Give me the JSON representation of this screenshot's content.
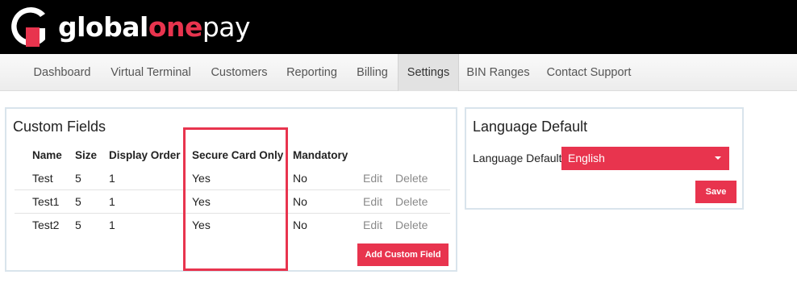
{
  "brand": {
    "part1": "global",
    "part2": "one",
    "part3": "pay",
    "accent_color": "#e8344e"
  },
  "nav": {
    "items": [
      {
        "label": "Dashboard"
      },
      {
        "label": "Virtual Terminal"
      },
      {
        "label": "Customers"
      },
      {
        "label": "Reporting"
      },
      {
        "label": "Billing"
      },
      {
        "label": "Settings",
        "active": true
      },
      {
        "label": "BIN Ranges"
      },
      {
        "label": "Contact Support"
      }
    ]
  },
  "custom_fields": {
    "title": "Custom Fields",
    "columns": [
      "Name",
      "Size",
      "Display Order",
      "Secure Card Only",
      "Mandatory"
    ],
    "rows": [
      {
        "name": "Test",
        "size": "5",
        "display_order": "1",
        "secure_card_only": "Yes",
        "mandatory": "No",
        "edit": "Edit",
        "delete": "Delete"
      },
      {
        "name": "Test1",
        "size": "5",
        "display_order": "1",
        "secure_card_only": "Yes",
        "mandatory": "No",
        "edit": "Edit",
        "delete": "Delete"
      },
      {
        "name": "Test2",
        "size": "5",
        "display_order": "1",
        "secure_card_only": "Yes",
        "mandatory": "No",
        "edit": "Edit",
        "delete": "Delete"
      }
    ],
    "add_button": "Add Custom Field"
  },
  "language_default": {
    "title": "Language Default",
    "label": "Language Default",
    "selected": "English",
    "save_button": "Save"
  }
}
